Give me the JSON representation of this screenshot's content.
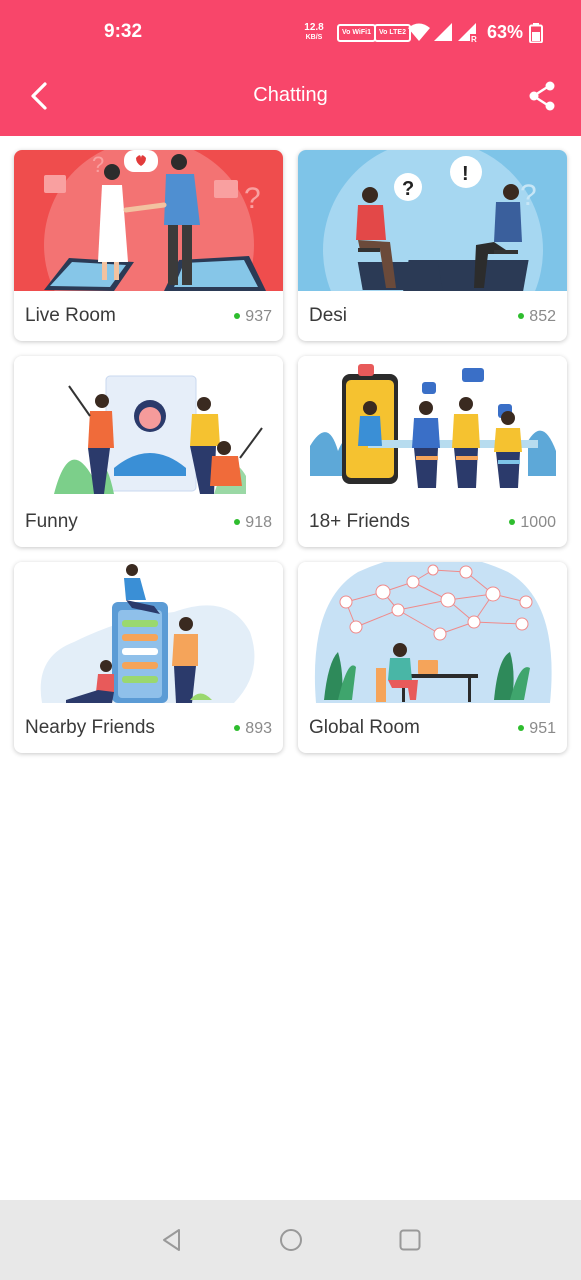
{
  "status_bar": {
    "time": "9:32",
    "net_speed": "12.8",
    "net_speed_unit": "KB/S",
    "sim1_label": "Vo WiFi1",
    "sim2_label": "Vo LTE2",
    "battery": "63%"
  },
  "app_bar": {
    "title": "Chatting",
    "back_icon": "chevron-left-icon",
    "share_icon": "share-icon"
  },
  "rooms": [
    {
      "name": "Live Room",
      "count": "937",
      "illustration": "handshake-illustration"
    },
    {
      "name": "Desi",
      "count": "852",
      "illustration": "conversation-illustration"
    },
    {
      "name": "Funny",
      "count": "918",
      "illustration": "selfie-group-illustration"
    },
    {
      "name": "18+ Friends",
      "count": "1000",
      "illustration": "meeting-table-illustration"
    },
    {
      "name": "Nearby Friends",
      "count": "893",
      "illustration": "phone-messages-illustration"
    },
    {
      "name": "Global Room",
      "count": "951",
      "illustration": "global-network-illustration"
    }
  ],
  "colors": {
    "primary": "#f8466a",
    "online": "#2ebd2e",
    "nav_bar": "#e8e8e8"
  }
}
